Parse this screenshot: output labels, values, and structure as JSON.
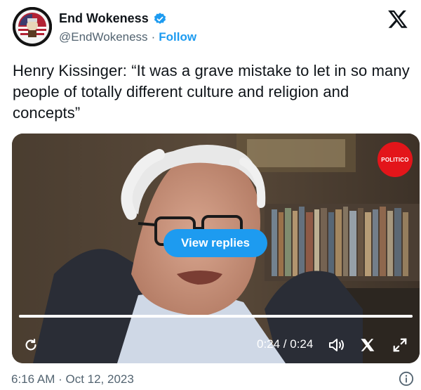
{
  "author": {
    "name": "End Wokeness",
    "handle": "@EndWokeness",
    "separator": "·",
    "follow_label": "Follow",
    "avatar_icon": "avatar-image",
    "verified_icon": "verified-badge-icon",
    "verified_color": "#1d9bf0"
  },
  "platform_icon": "x-logo-icon",
  "tweet": {
    "text": "Henry Kissinger: “It was a grave mistake to let in so many people of totally different culture and religion and concepts”"
  },
  "video": {
    "source_badge": "POLITICO",
    "overlay_button": "View replies",
    "time": "0:24 / 0:24",
    "progress": 1.0,
    "controls": {
      "replay_icon": "replay-icon",
      "volume_icon": "volume-icon",
      "close_icon": "close-icon",
      "fullscreen_icon": "fullscreen-icon"
    }
  },
  "footer": {
    "timestamp": "6:16 AM · Oct 12, 2023",
    "info_icon": "info-icon"
  },
  "colors": {
    "accent": "#1d9bf0",
    "secondary_text": "#536471",
    "politico_red": "#e3151a"
  }
}
